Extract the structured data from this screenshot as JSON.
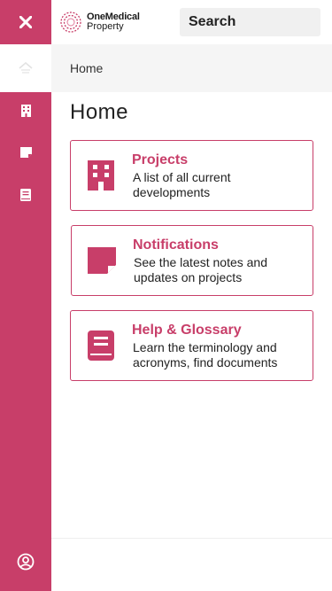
{
  "app": {
    "brand_line1": "OneMedical",
    "brand_line2": "Property",
    "accent_color": "#c83e69"
  },
  "rail": {
    "close_icon": "close-icon",
    "home_icon": "home-icon",
    "projects_icon": "building-icon",
    "notifications_icon": "note-icon",
    "help_icon": "book-icon",
    "account_icon": "user-circle-icon"
  },
  "search": {
    "placeholder": "Search"
  },
  "breadcrumb": {
    "current": "Home"
  },
  "page": {
    "title": "Home"
  },
  "cards": [
    {
      "title": "Projects",
      "description": "A list of all current developments",
      "icon": "building-icon"
    },
    {
      "title": "Notifications",
      "description": "See the latest notes and updates on projects",
      "icon": "note-icon"
    },
    {
      "title": "Help & Glossary",
      "description": "Learn the terminology and acronyms, find documents",
      "icon": "book-icon"
    }
  ]
}
